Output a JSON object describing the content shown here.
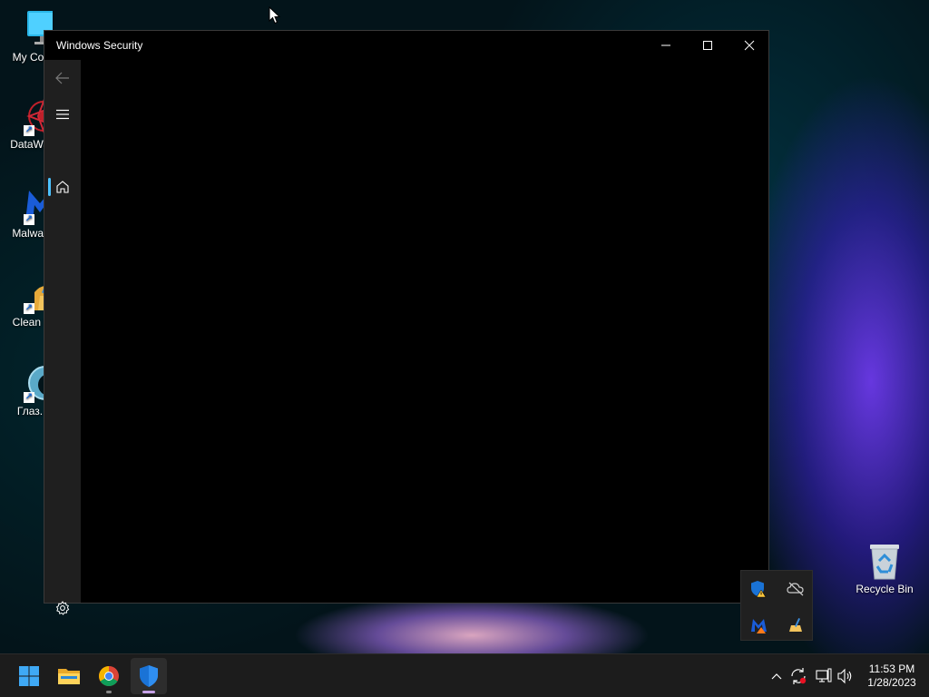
{
  "desktop": {
    "icons": [
      {
        "label": "My Com",
        "icon": "monitor-icon"
      },
      {
        "label": "DataWag",
        "icon": "datawag-icon"
      },
      {
        "label": "Malware",
        "icon": "malwarebytes-icon"
      },
      {
        "label": "Clean M",
        "icon": "clean-master-icon"
      },
      {
        "label": "Глаз.",
        "icon": "glaz-icon"
      }
    ],
    "recycle_bin": {
      "label": "Recycle Bin",
      "icon": "recycle-bin-icon"
    }
  },
  "window": {
    "title": "Windows Security",
    "controls": [
      "minimize-icon",
      "maximize-icon",
      "close-icon"
    ],
    "nav_rail": [
      "back-arrow-icon",
      "hamburger-menu-icon",
      "home-icon",
      "settings-gear-icon"
    ],
    "accent_color": "#4cc2ff"
  },
  "tray_flyout": {
    "icons": [
      "windows-security-warning-icon",
      "onedrive-offline-icon",
      "malwarebytes-tray-icon",
      "clean-master-tray-icon"
    ]
  },
  "taskbar": {
    "apps": [
      "start-icon",
      "file-explorer-icon",
      "chrome-icon",
      "windows-security-icon"
    ],
    "system_icons": [
      "show-hidden-icons-chevron-icon",
      "sync-alert-icon",
      "network-icon",
      "volume-icon"
    ],
    "clock": {
      "time": "11:53 PM",
      "date": "1/28/2023"
    }
  }
}
